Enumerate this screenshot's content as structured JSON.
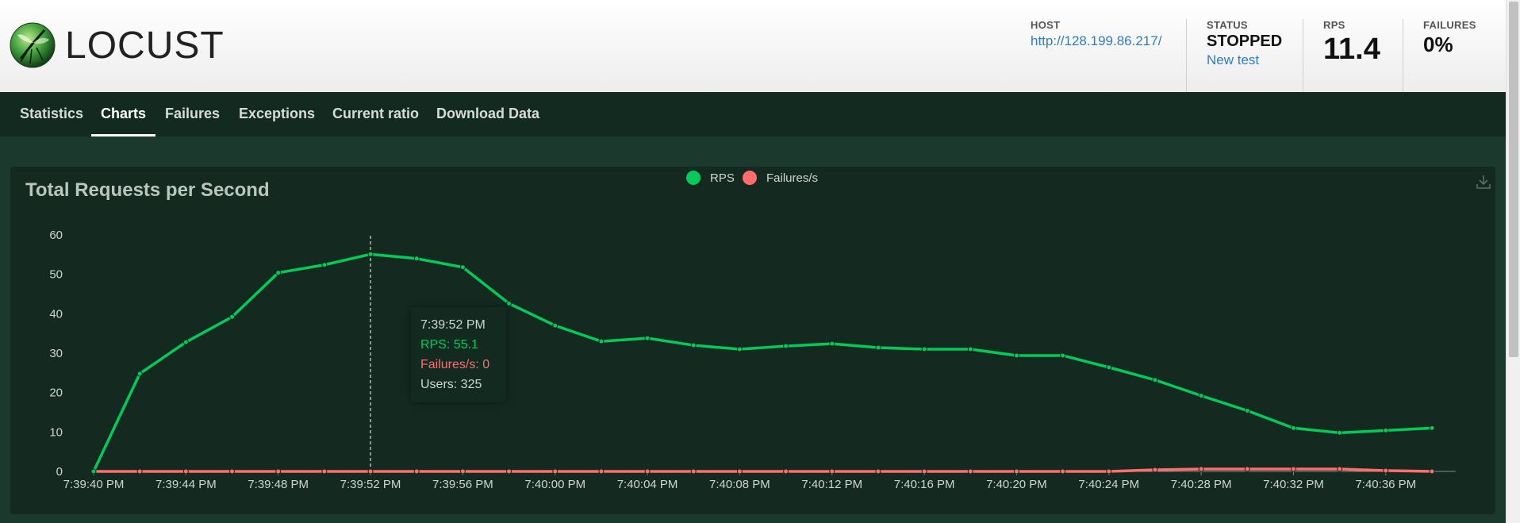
{
  "app": {
    "name": "LOCUST"
  },
  "header": {
    "host_label": "HOST",
    "host_value": "http://128.199.86.217/",
    "status_label": "STATUS",
    "status_value": "STOPPED",
    "new_test_label": "New test",
    "rps_label": "RPS",
    "rps_value": "11.4",
    "failures_label": "FAILURES",
    "failures_value": "0%"
  },
  "nav": {
    "tabs": [
      {
        "label": "Statistics",
        "active": false
      },
      {
        "label": "Charts",
        "active": true
      },
      {
        "label": "Failures",
        "active": false
      },
      {
        "label": "Exceptions",
        "active": false
      },
      {
        "label": "Current ratio",
        "active": false
      },
      {
        "label": "Download Data",
        "active": false
      }
    ]
  },
  "tooltip": {
    "time": "7:39:52 PM",
    "rps": "RPS: 55.1",
    "failures": "Failures/s: 0",
    "users": "Users: 325"
  },
  "colors": {
    "rps": "#00ca5a",
    "failures": "#ff6d6d",
    "panel_bg": "#142a20",
    "content_bg": "#1b3a2d",
    "nav_bg": "#132a21",
    "link": "#2f7cc5"
  },
  "icons": [
    "locust-logo",
    "download-icon"
  ],
  "chart_data": {
    "type": "line",
    "title": "Total Requests per Second",
    "x": [
      "7:39:40 PM",
      "7:39:42 PM",
      "7:39:44 PM",
      "7:39:46 PM",
      "7:39:48 PM",
      "7:39:50 PM",
      "7:39:52 PM",
      "7:39:54 PM",
      "7:39:56 PM",
      "7:39:58 PM",
      "7:40:00 PM",
      "7:40:02 PM",
      "7:40:04 PM",
      "7:40:06 PM",
      "7:40:08 PM",
      "7:40:10 PM",
      "7:40:12 PM",
      "7:40:14 PM",
      "7:40:16 PM",
      "7:40:18 PM",
      "7:40:20 PM",
      "7:40:22 PM",
      "7:40:24 PM",
      "7:40:26 PM",
      "7:40:28 PM",
      "7:40:30 PM",
      "7:40:32 PM",
      "7:40:34 PM",
      "7:40:36 PM",
      "7:40:38 PM"
    ],
    "x_tick_labels": [
      "7:39:40 PM",
      "7:39:44 PM",
      "7:39:48 PM",
      "7:39:52 PM",
      "7:39:56 PM",
      "7:40:00 PM",
      "7:40:04 PM",
      "7:40:08 PM",
      "7:40:12 PM",
      "7:40:16 PM",
      "7:40:20 PM",
      "7:40:24 PM",
      "7:40:28 PM",
      "7:40:32 PM",
      "7:40:36 PM"
    ],
    "y_ticks": [
      0,
      10,
      20,
      30,
      40,
      50,
      60
    ],
    "ylim": [
      0,
      60
    ],
    "legend": "top-center",
    "grid": false,
    "series": [
      {
        "name": "RPS",
        "color": "#00ca5a",
        "values": [
          0,
          24.8,
          32.8,
          39.2,
          50.4,
          52.4,
          55.1,
          54.0,
          51.8,
          42.6,
          37.0,
          33.0,
          33.8,
          32.0,
          31.0,
          31.8,
          32.4,
          31.4,
          31.0,
          31.0,
          29.4,
          29.4,
          26.4,
          23.2,
          19.2,
          15.4,
          11.0,
          9.8,
          10.4,
          11.0
        ]
      },
      {
        "name": "Failures/s",
        "color": "#ff6d6d",
        "values": [
          0,
          0,
          0,
          0,
          0,
          0,
          0,
          0,
          0,
          0,
          0,
          0,
          0,
          0,
          0,
          0,
          0,
          0,
          0,
          0,
          0,
          0,
          0,
          0.4,
          0.6,
          0.6,
          0.6,
          0.6,
          0.2,
          0
        ]
      }
    ],
    "highlight_index": 6
  }
}
